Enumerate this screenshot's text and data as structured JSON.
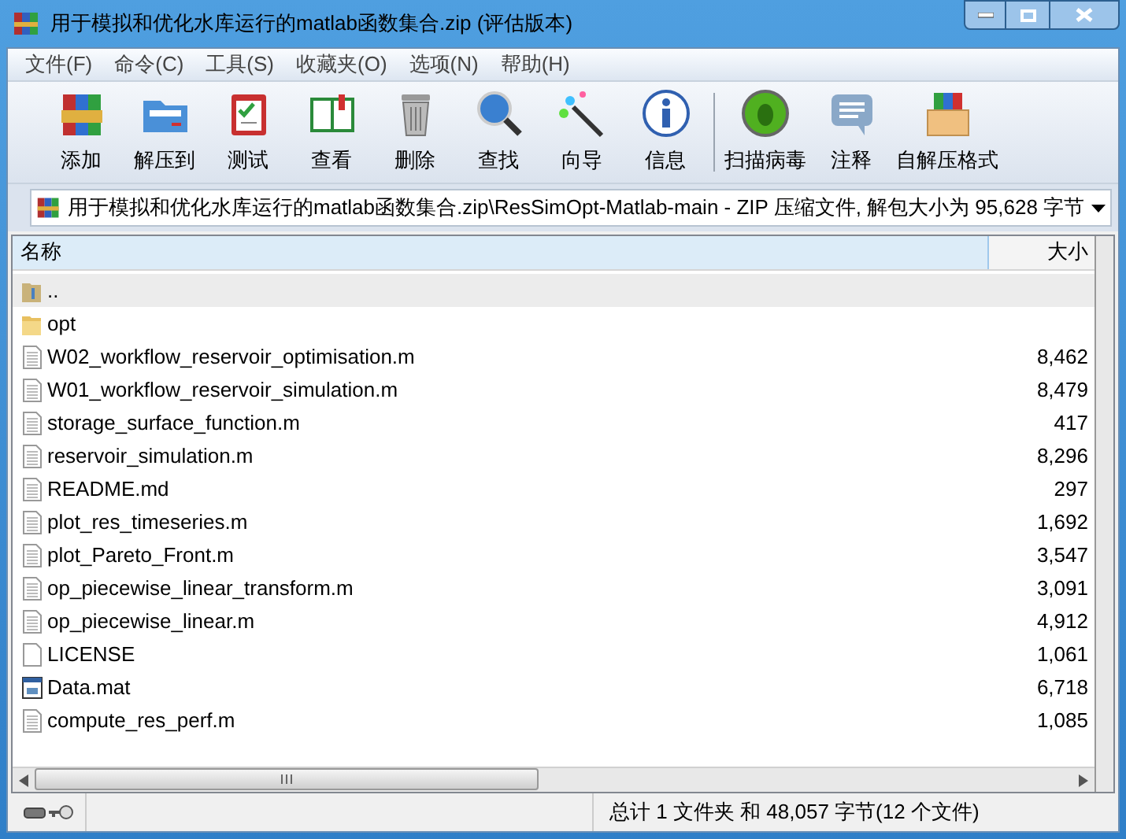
{
  "window": {
    "title": "用于模拟和优化水库运行的matlab函数集合.zip (评估版本)"
  },
  "menu": [
    "文件(F)",
    "命令(C)",
    "工具(S)",
    "收藏夹(O)",
    "选项(N)",
    "帮助(H)"
  ],
  "toolbar": [
    {
      "label": "添加"
    },
    {
      "label": "解压到"
    },
    {
      "label": "测试"
    },
    {
      "label": "查看"
    },
    {
      "label": "删除"
    },
    {
      "label": "查找"
    },
    {
      "label": "向导"
    },
    {
      "label": "信息"
    },
    {
      "label": "扫描病毒"
    },
    {
      "label": "注释"
    },
    {
      "label": "自解压格式"
    }
  ],
  "address": "用于模拟和优化水库运行的matlab函数集合.zip\\ResSimOpt-Matlab-main - ZIP 压缩文件, 解包大小为 95,628 字节",
  "table": {
    "columns": [
      "名称",
      "大小"
    ],
    "rows": [
      {
        "kind": "up",
        "name": "..",
        "size": "",
        "selected": true
      },
      {
        "kind": "folder",
        "name": "opt",
        "size": "",
        "selected": false
      },
      {
        "kind": "text",
        "name": "W02_workflow_reservoir_optimisation.m",
        "size": "8,462",
        "selected": false
      },
      {
        "kind": "text",
        "name": "W01_workflow_reservoir_simulation.m",
        "size": "8,479",
        "selected": false
      },
      {
        "kind": "text",
        "name": "storage_surface_function.m",
        "size": "417",
        "selected": false
      },
      {
        "kind": "text",
        "name": "reservoir_simulation.m",
        "size": "8,296",
        "selected": false
      },
      {
        "kind": "text",
        "name": "README.md",
        "size": "297",
        "selected": false
      },
      {
        "kind": "text",
        "name": "plot_res_timeseries.m",
        "size": "1,692",
        "selected": false
      },
      {
        "kind": "text",
        "name": "plot_Pareto_Front.m",
        "size": "3,547",
        "selected": false
      },
      {
        "kind": "text",
        "name": "op_piecewise_linear_transform.m",
        "size": "3,091",
        "selected": false
      },
      {
        "kind": "text",
        "name": "op_piecewise_linear.m",
        "size": "4,912",
        "selected": false
      },
      {
        "kind": "plain",
        "name": "LICENSE",
        "size": "1,061",
        "selected": false
      },
      {
        "kind": "mat",
        "name": "Data.mat",
        "size": "6,718",
        "selected": false
      },
      {
        "kind": "text",
        "name": "compute_res_perf.m",
        "size": "1,085",
        "selected": false
      }
    ]
  },
  "status_bar": "总计 1 文件夹 和 48,057 字节(12 个文件)"
}
